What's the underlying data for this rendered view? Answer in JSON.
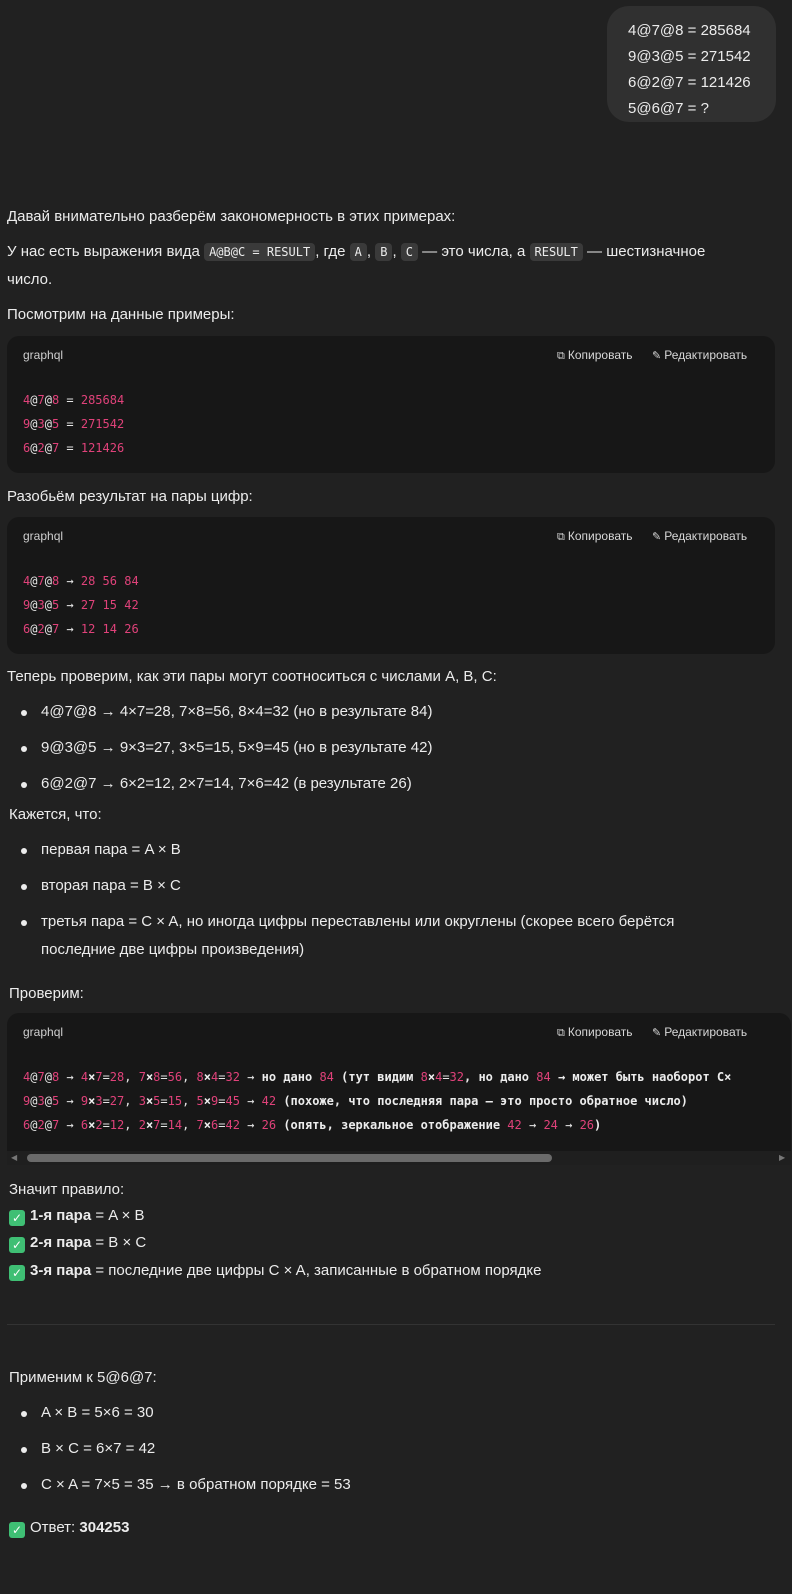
{
  "user_message": [
    "4@7@8 = 285684",
    "9@3@5 = 271542",
    "6@2@7 = 121426",
    "5@6@7 = ?"
  ],
  "intro": "Давай внимательно разберём закономерность в этих примерах:",
  "p1": {
    "t1": "У нас есть выражения вида ",
    "c1": "A@B@C = RESULT",
    "t2": ", где ",
    "c2": "A",
    "t3": ", ",
    "c3": "B",
    "t4": ", ",
    "c4": "C",
    "t5": " — это числа, а ",
    "c5": "RESULT",
    "t6": " — шестизначное",
    "line2": "число."
  },
  "look": "Посмотрим на данные примеры:",
  "code": {
    "lang": "graphql",
    "copy": "Копировать",
    "edit": "Редактировать",
    "copy_icon": "copy-icon",
    "edit_icon": "pencil-icon"
  },
  "split": "Разобьём результат на пары цифр:",
  "check": "Теперь проверим, как эти пары могут соотноситься с числами A, B, C:",
  "bullets1": [
    "4@7@8 → 4×7=28, 7×8=56, 8×4=32 (но в результате 84)",
    "9@3@5 → 9×3=27, 3×5=15, 5×9=45 (но в результате 42)",
    "6@2@7 → 6×2=12, 2×7=14, 7×6=42 (в результате 26)"
  ],
  "seems": "Кажется, что:",
  "bullets2": [
    "первая пара = A × B",
    "вторая пара = B × C",
    "третья пара = C × A, но иногда цифры переставлены или округлены (скорее всего берётся",
    "последние две цифры произведения)"
  ],
  "verify": "Проверим:",
  "rule": {
    "title": "Значит правило:",
    "items": [
      {
        "b": "1-я пара",
        "t": " = A × B"
      },
      {
        "b": "2-я пара",
        "t": " = B × C"
      },
      {
        "b": "3-я пара",
        "t": " = последние две цифры C × A, записанные в обратном порядке"
      }
    ],
    "check_icon": "check-icon"
  },
  "apply": "Применим к 5@6@7:",
  "bullets3": [
    "A × B = 5×6 = 30",
    "B × C = 6×7 = 42",
    "C × A = 7×5 = 35 → в обратном порядке = 53"
  ],
  "answer": {
    "label": "Ответ: ",
    "value": "304253"
  }
}
